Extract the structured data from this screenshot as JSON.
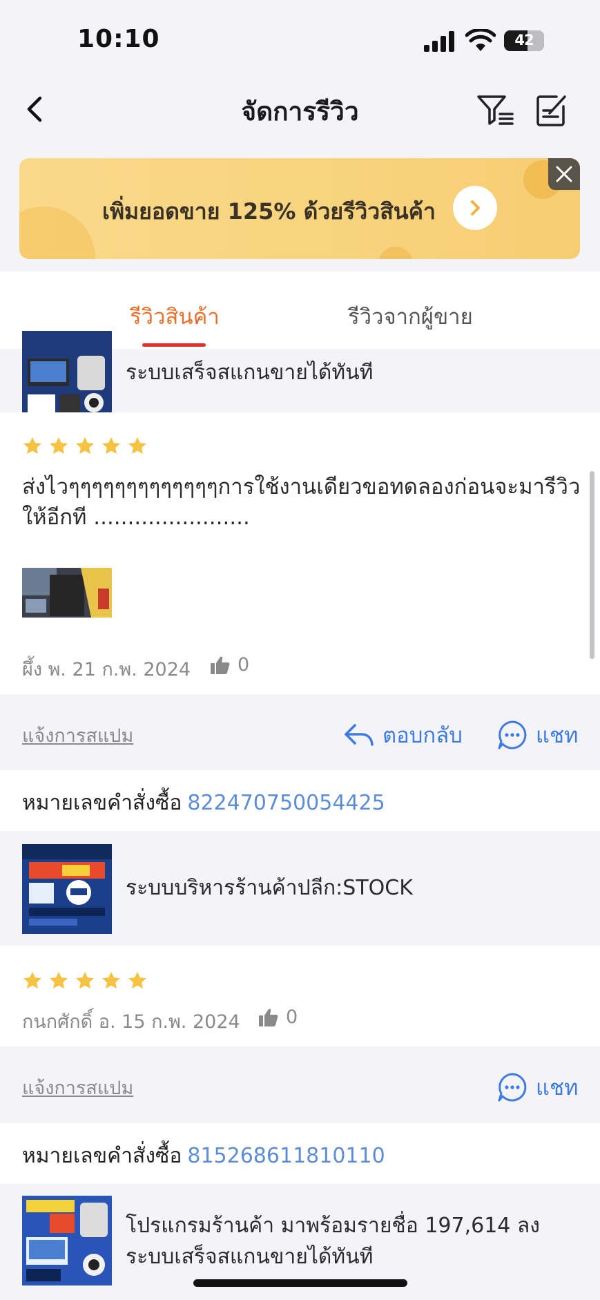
{
  "status_bar": {
    "time": "10:10",
    "battery": "42"
  },
  "header": {
    "title": "จัดการรีวิว"
  },
  "banner": {
    "text": "เพิ่มยอดขาย 125% ด้วยรีวิวสินค้า"
  },
  "tabs": [
    {
      "label": "รีวิวสินค้า",
      "active": true
    },
    {
      "label": "รีวิวจากผู้ขาย",
      "active": false
    }
  ],
  "reviews": [
    {
      "product_name": "ระบบเสร็จสแกนขายได้ทันที",
      "rating": 5,
      "text": "ส่งไวๆๆๆๆๆๆๆๆๆๆๆๆๆการใช้งานเดียวขอทดลองก่อนจะมารีวิวให้อีกที .......................",
      "reviewer_date": "ผึ้ง พ. 21 ก.พ. 2024",
      "likes": "0",
      "spam_label": "แจ้งการสแปม",
      "reply_label": "ตอบกลับ",
      "chat_label": "แชท"
    },
    {
      "order_label": "หมายเลขคำสั่งซื้อ",
      "order_number": "822470750054425",
      "product_name": "ระบบบริหารร้านค้าปลีก:STOCK",
      "rating": 5,
      "reviewer_date": "กนกศักดิ์ อ. 15 ก.พ. 2024",
      "likes": "0",
      "spam_label": "แจ้งการสแปม",
      "chat_label": "แชท"
    },
    {
      "order_label": "หมายเลขคำสั่งซื้อ",
      "order_number": "815268611810110",
      "product_name_line1": "โปรแกรมร้านค้า มาพร้อมรายชื่อ 197,614 ลง",
      "product_name_line2": "ระบบเสร็จสแกนขายได้ทันที"
    }
  ],
  "colors": {
    "accent": "#e8702a",
    "tab_underline": "#e8302a",
    "link_blue": "#3d7be0",
    "order_blue": "#5c8dd6",
    "star": "#f5c242",
    "banner": "#f8d37d"
  }
}
